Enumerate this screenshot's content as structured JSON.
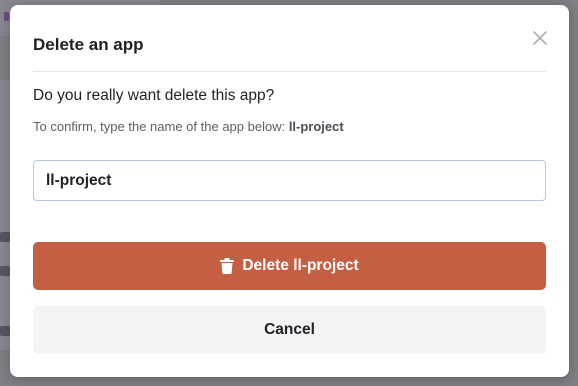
{
  "background": {
    "overlay_color": "#7f8085"
  },
  "modal": {
    "title": "Delete an app",
    "close_icon": "close-icon",
    "question": "Do you really want delete this app?",
    "confirm_hint_prefix": "To confirm, type the name of the app below: ",
    "app_name": "ll-project",
    "input_value": "ll-project",
    "delete_icon": "trash-icon",
    "delete_label": "Delete ll-project",
    "cancel_label": "Cancel"
  },
  "colors": {
    "danger": "#c55f44",
    "input_border": "#b8c6dc",
    "cancel_bg": "#f3f4f6"
  }
}
